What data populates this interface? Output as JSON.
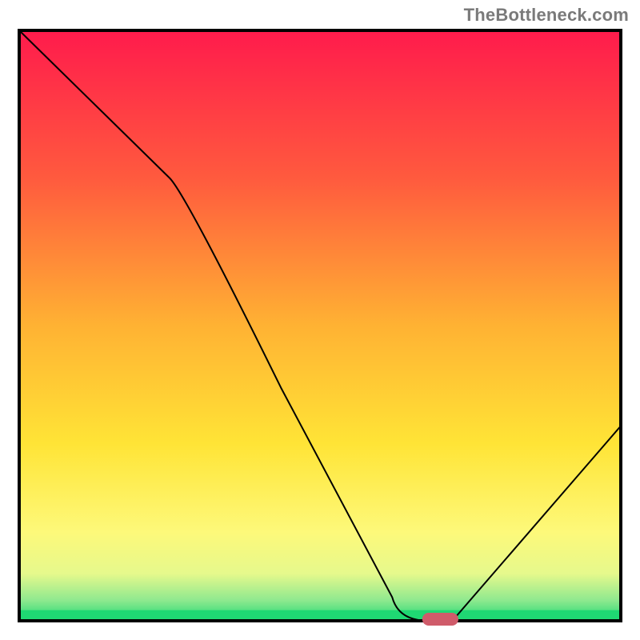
{
  "watermark": "TheBottleneck.com",
  "chart_data": {
    "type": "line",
    "title": "",
    "xlabel": "",
    "ylabel": "",
    "xlim": [
      0,
      100
    ],
    "ylim": [
      0,
      100
    ],
    "grid": false,
    "legend": false,
    "series": [
      {
        "name": "bottleneck-curve",
        "x": [
          0,
          25,
          62,
          68,
          72,
          100
        ],
        "values": [
          100,
          75,
          4,
          0,
          0,
          33
        ]
      }
    ],
    "marker": {
      "name": "optimal-marker",
      "x_range": [
        67,
        73
      ],
      "y": 0,
      "color": "#cf5b6a"
    },
    "background_gradient": {
      "stops": [
        {
          "pos": 0.0,
          "color": "#ff1b4c"
        },
        {
          "pos": 0.25,
          "color": "#ff5a3e"
        },
        {
          "pos": 0.5,
          "color": "#ffb233"
        },
        {
          "pos": 0.7,
          "color": "#ffe436"
        },
        {
          "pos": 0.85,
          "color": "#fdf97a"
        },
        {
          "pos": 0.92,
          "color": "#e6f98c"
        },
        {
          "pos": 0.965,
          "color": "#8fe98f"
        },
        {
          "pos": 1.0,
          "color": "#1fd873"
        }
      ]
    },
    "frame_color": "#000000",
    "curve_color": "#000000",
    "curve_width": 2
  }
}
